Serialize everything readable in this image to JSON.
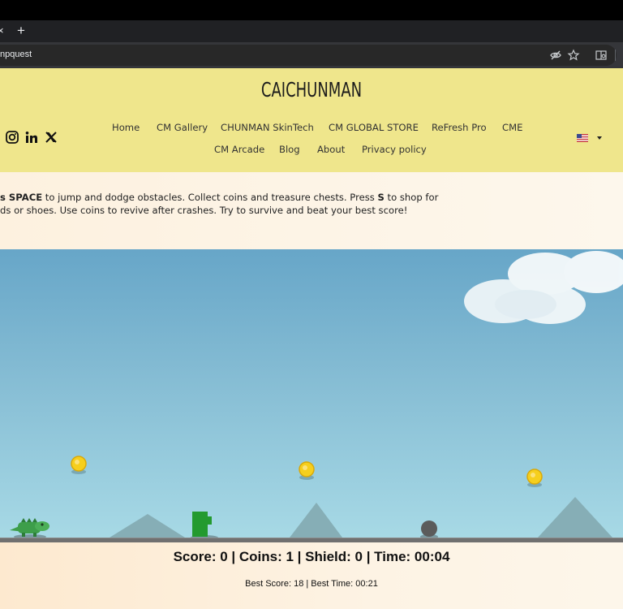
{
  "browser": {
    "tab_close": "×",
    "new_tab": "+",
    "url": "npquest",
    "icons": [
      "eye-off-icon",
      "star-icon",
      "reader-mode-icon"
    ]
  },
  "site": {
    "logo": "CAICHUNMAN",
    "social": [
      "instagram-icon",
      "linkedin-icon",
      "x-icon"
    ],
    "nav": [
      {
        "label": "Home"
      },
      {
        "label": "CM Gallery"
      },
      {
        "label": "CHUNMAN SkinTech"
      },
      {
        "label": "CM GLOBAL STORE"
      },
      {
        "label": "ReFresh Pro"
      },
      {
        "label": "CME"
      },
      {
        "label": "CM Arcade"
      },
      {
        "label": "Blog"
      },
      {
        "label": "About"
      },
      {
        "label": "Privacy policy"
      }
    ],
    "language_flag": "us-flag-icon"
  },
  "instructions": {
    "line1_bold1": "s SPACE",
    "line1_mid": " to jump and dodge obstacles. Collect coins and treasure chests. Press ",
    "line1_bold2": "S",
    "line1_end": " to shop for",
    "line2": "ds or shoes. Use coins to revive after crashes. Try to survive and beat your best score!"
  },
  "game": {
    "colors": {
      "sky_top": "#67a6c8",
      "sky_bottom": "#a8dae6",
      "ground": "#707070",
      "coin": "#f6cf1d",
      "player": "#3d9e4a",
      "obstacle": "#239a2f",
      "rock": "#5b5b5b"
    },
    "objects": [
      "cloud",
      "coin",
      "coin",
      "coin",
      "crocodile-player",
      "green-block-obstacle",
      "rock-obstacle",
      "mountain",
      "mountain",
      "mountain"
    ]
  },
  "hud": {
    "text": "Score: 0 | Coins: 1 | Shield: 0 | Time: 00:04",
    "best": "Best Score: 18 | Best Time: 00:21"
  }
}
